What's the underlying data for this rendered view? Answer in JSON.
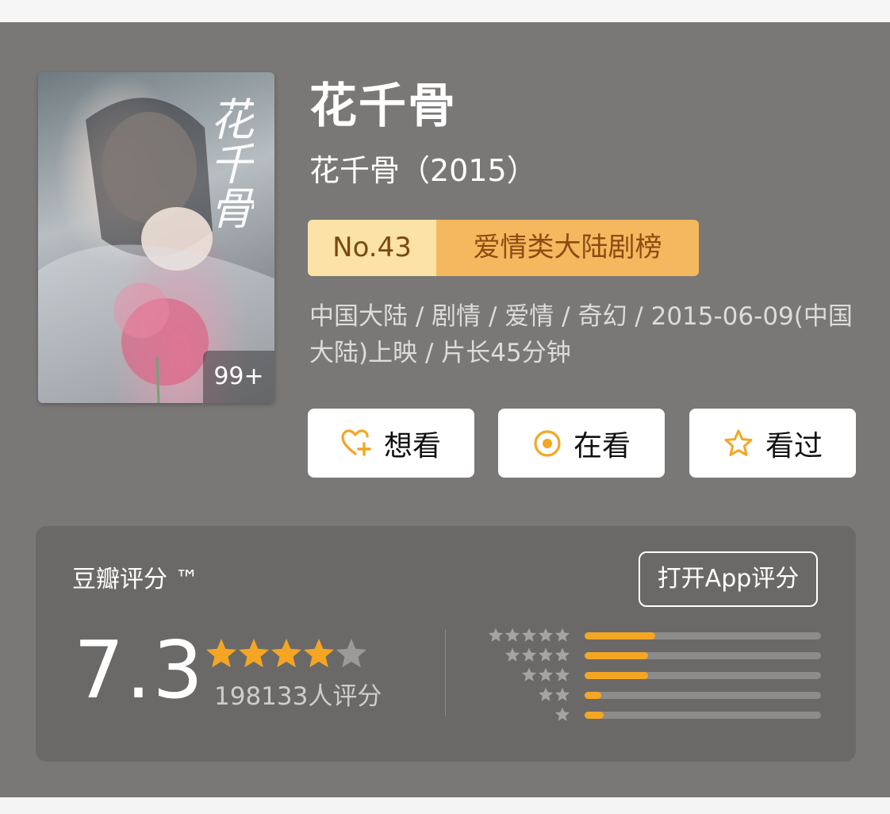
{
  "title": "花千骨",
  "subtitle": "花千骨（2015）",
  "poster": {
    "calligraphy": "花千骨",
    "badge": "99+"
  },
  "rank": {
    "number": "No.43",
    "category": "爱情类大陆剧榜"
  },
  "meta": "中国大陆 / 剧情 / 爱情 / 奇幻 / 2015-06-09(中国大陆)上映 / 片长45分钟",
  "actions": {
    "want_label": "想看",
    "watching_label": "在看",
    "seen_label": "看过",
    "want_icon": "heart-plus-icon",
    "watching_icon": "target-circle-icon",
    "seen_icon": "star-outline-icon"
  },
  "rating": {
    "label": "豆瓣评分 ™",
    "open_app_label": "打开App评分",
    "score": "7.3",
    "stars": 3.5,
    "count_text": "198133人评分",
    "distribution": [
      {
        "stars": 5,
        "fraction": 0.3
      },
      {
        "stars": 4,
        "fraction": 0.27
      },
      {
        "stars": 3,
        "fraction": 0.27
      },
      {
        "stars": 2,
        "fraction": 0.07
      },
      {
        "stars": 1,
        "fraction": 0.08
      }
    ]
  },
  "colors": {
    "panel_bg": "#7a7877",
    "card_bg": "#6b6968",
    "accent_orange": "#f4a623",
    "rank_light": "#fbe2a6",
    "rank_dark": "#f4b85e"
  }
}
